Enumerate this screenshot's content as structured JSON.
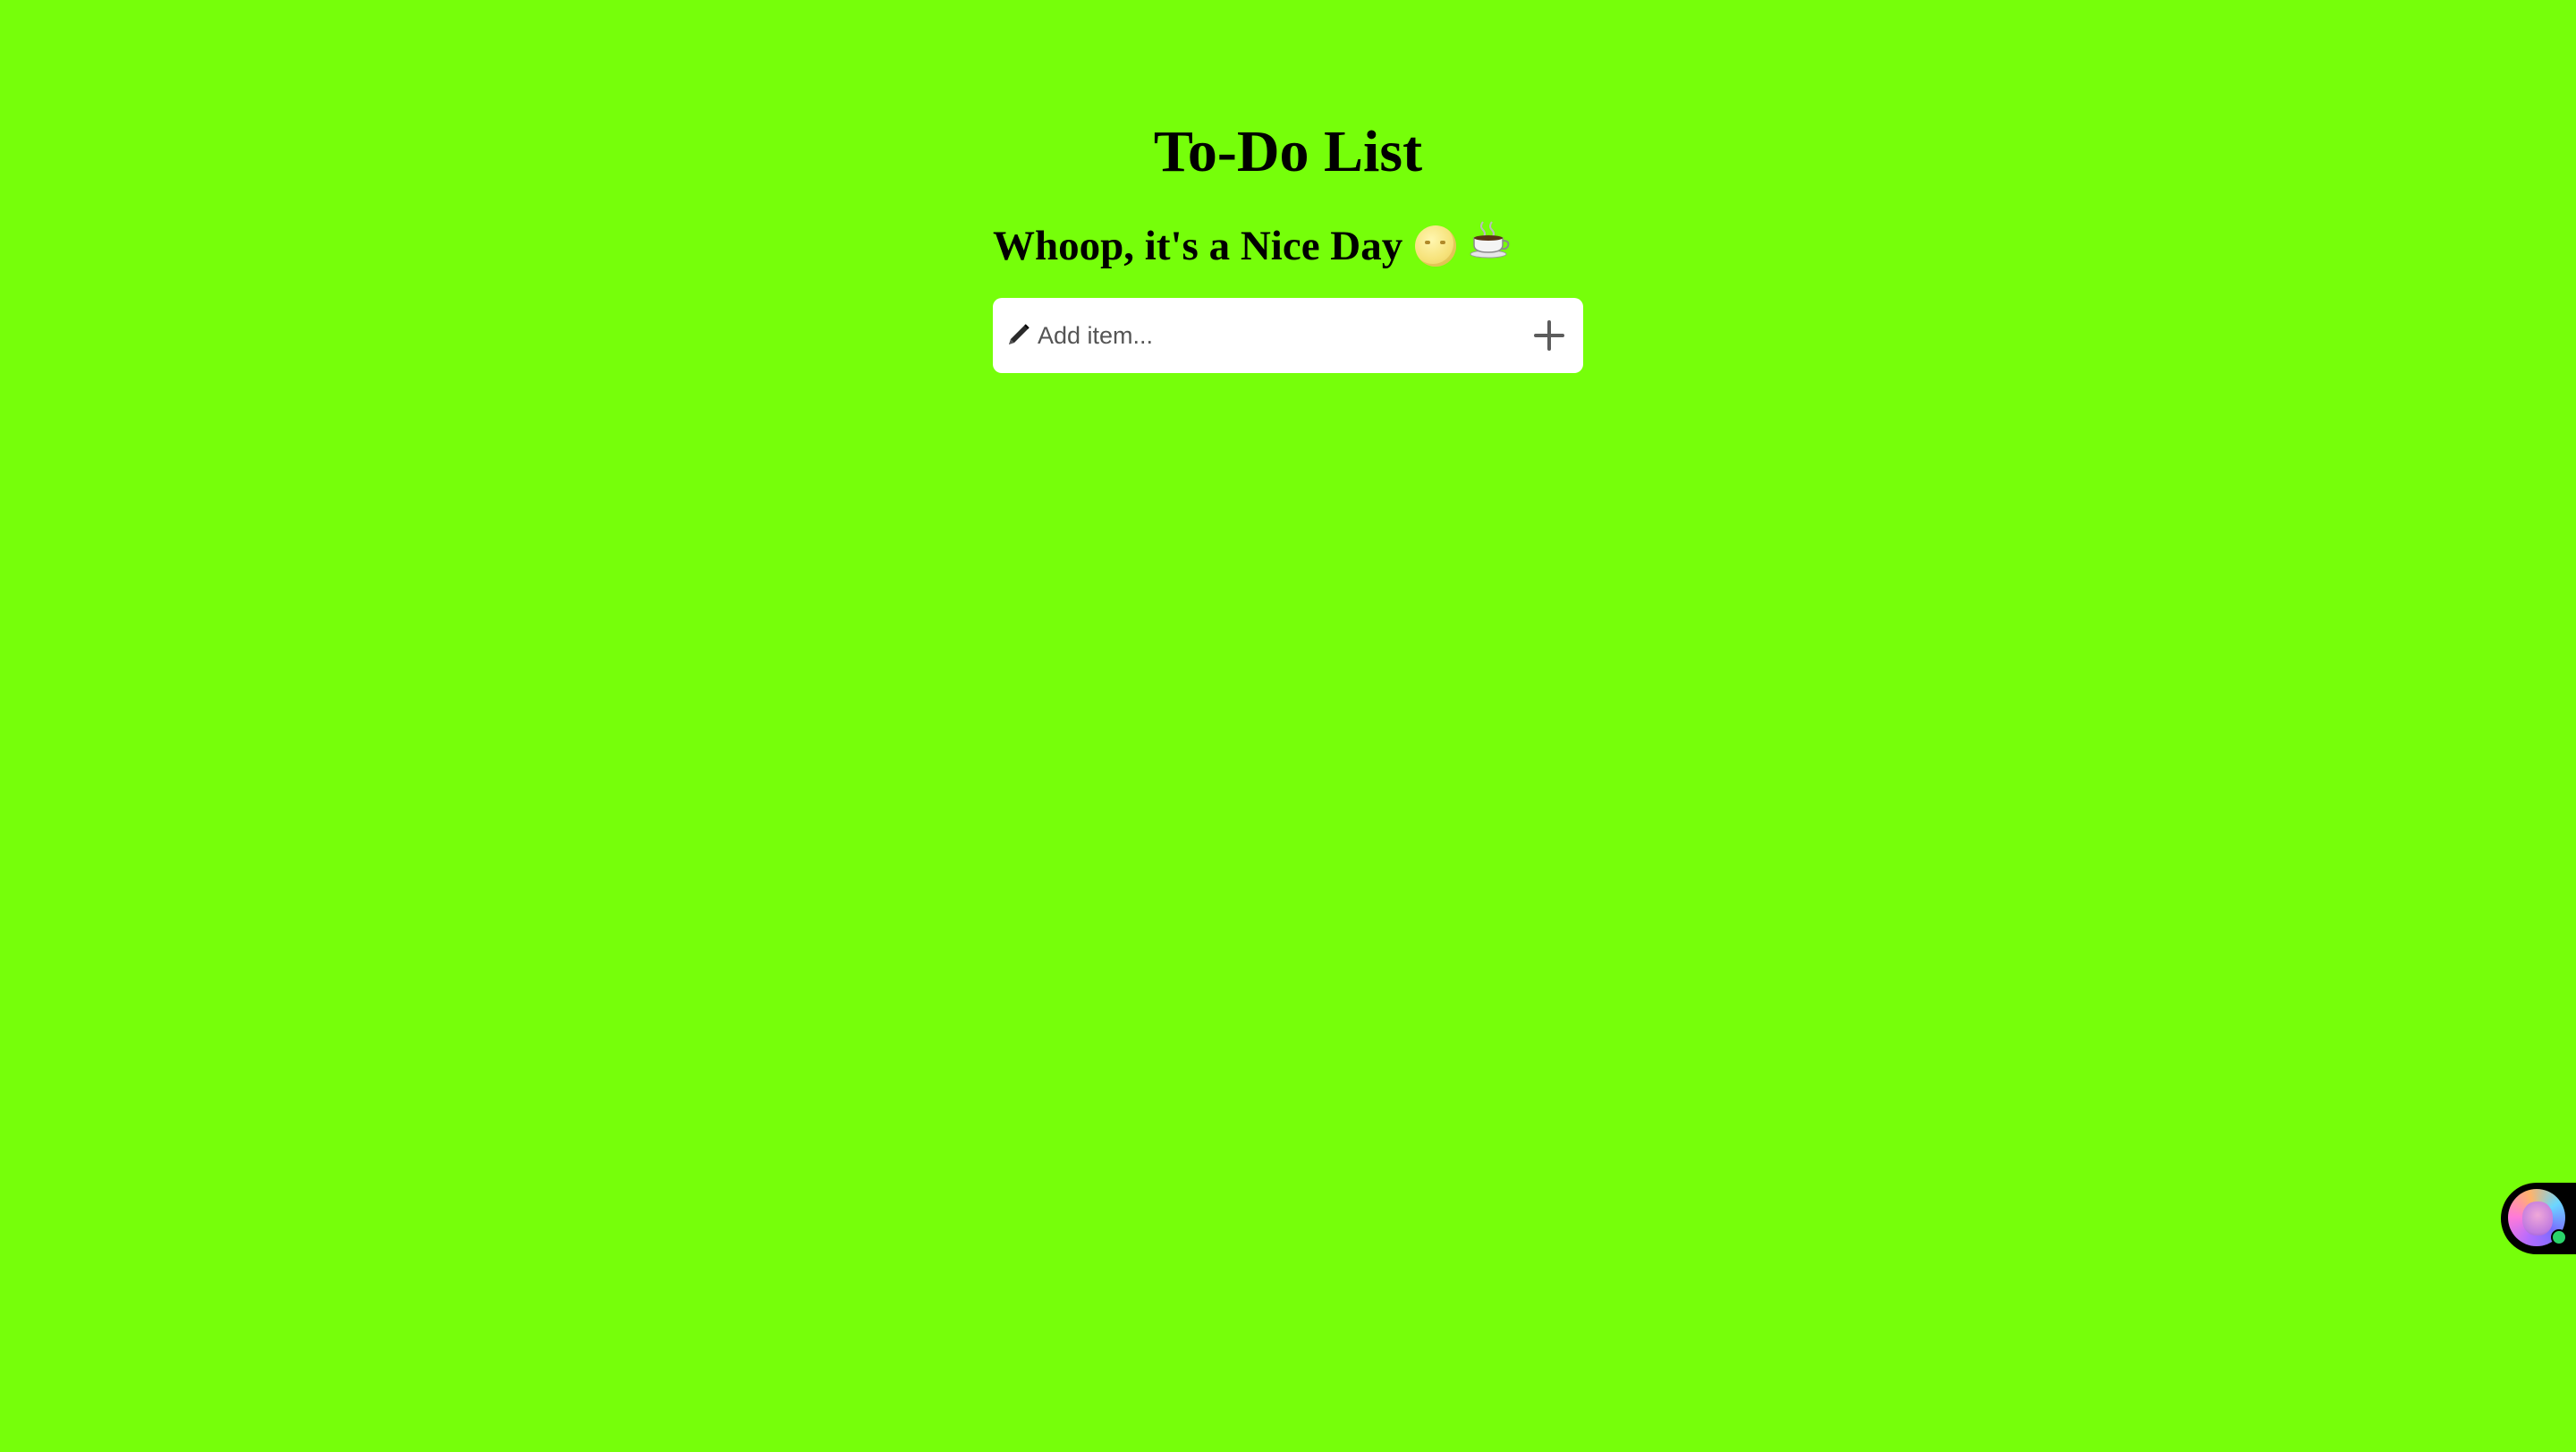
{
  "page": {
    "title": "To-Do List",
    "subtitle": "Whoop, it's a Nice Day",
    "subtitle_emojis": [
      "moon-face-icon",
      "coffee-icon"
    ]
  },
  "add_item": {
    "placeholder": "Add item...",
    "value": "",
    "leading_icon": "pencil-icon",
    "button_icon": "plus-icon"
  },
  "assistant_widget": {
    "icon": "assistant-avatar-icon",
    "status": "online"
  },
  "colors": {
    "background": "#76ff0a",
    "input_background": "#ffffff",
    "status_online": "#2ad46a"
  }
}
